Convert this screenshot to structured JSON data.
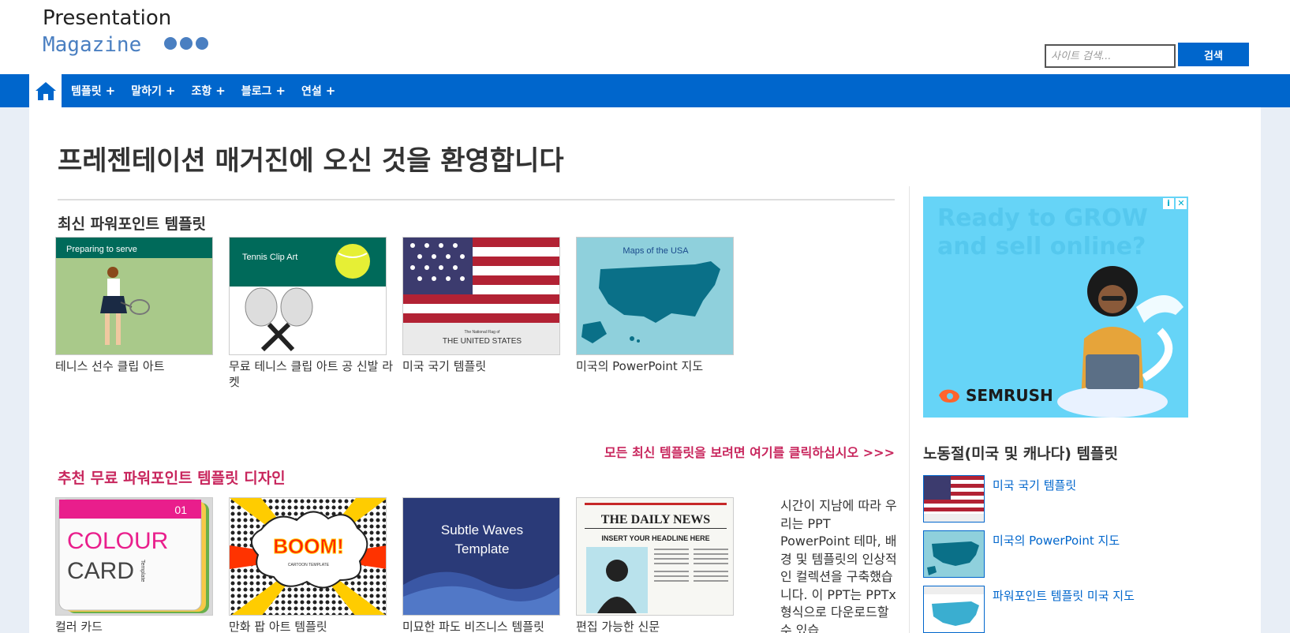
{
  "header": {
    "logo_line1": "Presentation",
    "logo_line2": "Magazine",
    "search_placeholder": "사이트 검색...",
    "search_button": "검색"
  },
  "nav": {
    "home_icon": "home-icon",
    "items": [
      {
        "label": "템플릿"
      },
      {
        "label": "말하기"
      },
      {
        "label": "조항"
      },
      {
        "label": "블로그"
      },
      {
        "label": "연설"
      }
    ],
    "plus": "+"
  },
  "main": {
    "title": "프레젠테이션 매거진에 오신 것을 환영합니다",
    "latest_title": "최신 파워포인트 템플릿",
    "latest_items": [
      {
        "caption": "테니스 선수 클립 아트",
        "thumb_text": "Preparing to serve"
      },
      {
        "caption": "무료 테니스 클립 아트 공 신발 라켓",
        "thumb_text": "Tennis Clip Art"
      },
      {
        "caption": "미국 국기 템플릿",
        "thumb_text": "THE UNITED STATES",
        "thumb_subtext": "The National Flag of"
      },
      {
        "caption": "미국의 PowerPoint 지도",
        "thumb_text": "Maps of the USA"
      }
    ],
    "see_all": "모든 최신 템플릿을 보려면 여기를 클릭하십시오 >>>",
    "featured_title": "추천 무료 파워포인트 템플릿 디자인",
    "featured_items": [
      {
        "caption": "컬러 카드",
        "thumb_line1": "COLOUR",
        "thumb_line2": "CARD",
        "thumb_num": "01",
        "thumb_side": "Template"
      },
      {
        "caption": "만화 팝 아트 템플릿",
        "thumb_text": "BOOM!",
        "thumb_sub": "CARTOON TEMPLATE"
      },
      {
        "caption": "미묘한 파도 비즈니스 템플릿",
        "thumb_line1": "Subtle Waves",
        "thumb_line2": "Template"
      },
      {
        "caption": "편집 가능한 신문",
        "thumb_head": "THE DAILY NEWS",
        "thumb_sub": "INSERT YOUR HEADLINE HERE"
      }
    ],
    "side_text": "시간이 지남에 따라 우리는 PPT PowerPoint 테마, 배경 및 템플릿의 인상적인 컬렉션을 구축했습니다. 이 PPT는 PPTx 형식으로 다운로드할 수 있습"
  },
  "sidebar": {
    "ad_text_line1": "Ready to GROW",
    "ad_text_line2": "and sell online?",
    "ad_brand": "SEMRUSH",
    "ad_info_icon": "info-icon",
    "ad_close_icon": "close-icon",
    "title": "노동절(미국 및 캐나다) 템플릿",
    "items": [
      {
        "label": "미국 국기 템플릿"
      },
      {
        "label": "미국의 PowerPoint 지도"
      },
      {
        "label": "파워포인트 템플릿 미국 지도"
      }
    ]
  },
  "colors": {
    "nav_blue": "#0066cc",
    "accent_pink": "#c8265d",
    "logo_blue": "#4a7fc1"
  }
}
